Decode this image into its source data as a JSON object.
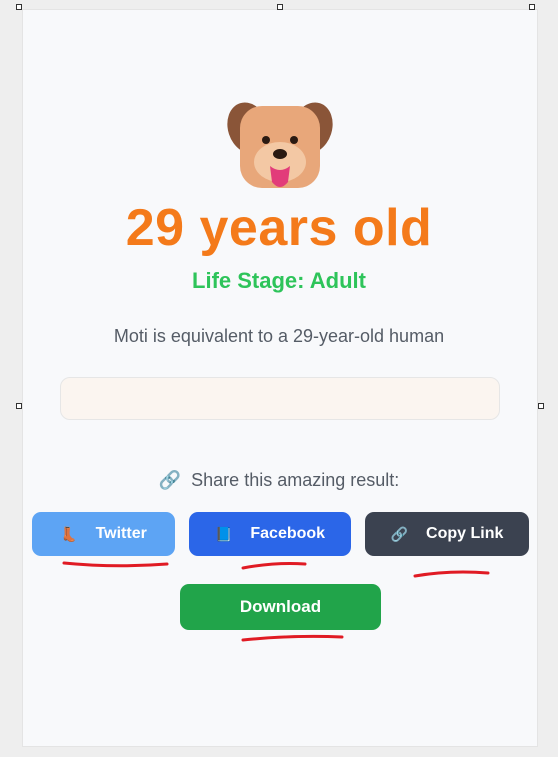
{
  "result": {
    "age_text": "29 years old",
    "life_stage": "Life Stage: Adult",
    "equivalent_text": "Moti is equivalent to a 29-year-old human"
  },
  "share": {
    "prompt": "Share this amazing result:",
    "twitter_label": "Twitter",
    "facebook_label": "Facebook",
    "copy_link_label": "Copy Link",
    "download_label": "Download"
  },
  "icons": {
    "avatar": "dog-face-icon",
    "share": "link-icon",
    "twitter": "boot-icon",
    "facebook": "book-icon",
    "copy_link": "link-icon"
  },
  "colors": {
    "age": "#f47a1a",
    "life_stage": "#2ec45a",
    "twitter": "#5da4f4",
    "facebook": "#2b66e8",
    "copy_link": "#3b4250",
    "download": "#21a44a",
    "annotation": "#e01b24"
  }
}
